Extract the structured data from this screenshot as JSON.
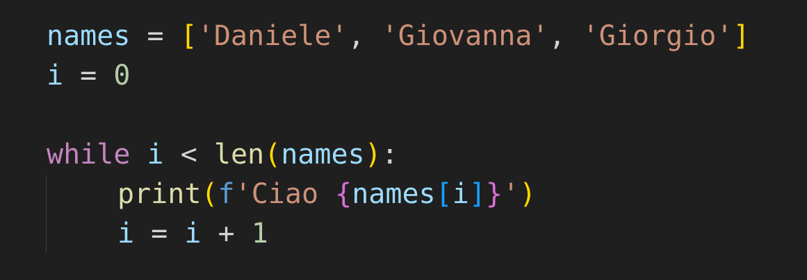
{
  "editor": {
    "language": "python",
    "background": "#1f1f1f",
    "lines": [
      {
        "tokens": [
          {
            "text": "names",
            "type": "variable"
          },
          {
            "text": " = ",
            "type": "operator"
          },
          {
            "text": "[",
            "type": "bracket-level-1"
          },
          {
            "text": "'Daniele'",
            "type": "string"
          },
          {
            "text": ", ",
            "type": "operator"
          },
          {
            "text": "'Giovanna'",
            "type": "string"
          },
          {
            "text": ", ",
            "type": "operator"
          },
          {
            "text": "'Giorgio'",
            "type": "string"
          },
          {
            "text": "]",
            "type": "bracket-level-1"
          }
        ]
      },
      {
        "tokens": [
          {
            "text": "i",
            "type": "variable"
          },
          {
            "text": " = ",
            "type": "operator"
          },
          {
            "text": "0",
            "type": "number"
          }
        ]
      },
      {
        "tokens": []
      },
      {
        "tokens": [
          {
            "text": "while",
            "type": "keyword"
          },
          {
            "text": " ",
            "type": "operator"
          },
          {
            "text": "i",
            "type": "variable"
          },
          {
            "text": " < ",
            "type": "operator"
          },
          {
            "text": "len",
            "type": "function"
          },
          {
            "text": "(",
            "type": "bracket-level-1"
          },
          {
            "text": "names",
            "type": "variable"
          },
          {
            "text": ")",
            "type": "bracket-level-1"
          },
          {
            "text": ":",
            "type": "operator"
          }
        ]
      },
      {
        "tokens": [
          {
            "text": "print",
            "type": "function"
          },
          {
            "text": "(",
            "type": "bracket-level-1"
          },
          {
            "text": "f",
            "type": "fstring-prefix"
          },
          {
            "text": "'Ciao ",
            "type": "string"
          },
          {
            "text": "{",
            "type": "bracket-level-2"
          },
          {
            "text": "names",
            "type": "variable"
          },
          {
            "text": "[",
            "type": "bracket-level-3"
          },
          {
            "text": "i",
            "type": "variable"
          },
          {
            "text": "]",
            "type": "bracket-level-3"
          },
          {
            "text": "}",
            "type": "bracket-level-2"
          },
          {
            "text": "'",
            "type": "string"
          },
          {
            "text": ")",
            "type": "bracket-level-1"
          }
        ]
      },
      {
        "tokens": [
          {
            "text": "i",
            "type": "variable"
          },
          {
            "text": " = ",
            "type": "operator"
          },
          {
            "text": "i",
            "type": "variable"
          },
          {
            "text": " + ",
            "type": "operator"
          },
          {
            "text": "1",
            "type": "number"
          }
        ]
      }
    ],
    "colors": {
      "variable": "#9cdcfe",
      "operator": "#d4d4d4",
      "number": "#b5cea8",
      "string": "#ce9178",
      "keyword": "#c586c0",
      "function": "#dcdcaa",
      "fstring_prefix": "#569cd6",
      "bracket_level_1": "#ffd700",
      "bracket_level_2": "#da70d6",
      "bracket_level_3": "#179fff",
      "indent_guide": "#404040"
    }
  }
}
